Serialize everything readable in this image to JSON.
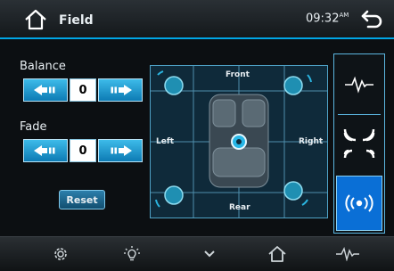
{
  "header": {
    "title": "Field",
    "time": "09:32",
    "time_suffix": "AM",
    "home_icon": "home-icon",
    "back_icon": "back-arrow-icon"
  },
  "balance": {
    "label": "Balance",
    "value": "0",
    "left_icon": "arrow-left-icon",
    "right_icon": "arrow-right-icon"
  },
  "fade": {
    "label": "Fade",
    "value": "0",
    "left_icon": "arrow-left-icon",
    "right_icon": "arrow-right-icon"
  },
  "reset_label": "Reset",
  "sound_field": {
    "front_label": "Front",
    "rear_label": "Rear",
    "left_label": "Left",
    "right_label": "Right"
  },
  "sidebar": {
    "items": [
      {
        "icon": "waveform-icon",
        "active": false
      },
      {
        "icon": "sound-waves-icon",
        "active": false
      },
      {
        "icon": "surround-icon",
        "active": true
      }
    ]
  },
  "bottom_nav": {
    "items": [
      {
        "icon": "gear-icon"
      },
      {
        "icon": "brightness-icon"
      },
      {
        "icon": "chevron-down-icon"
      },
      {
        "icon": "home-icon"
      },
      {
        "icon": "waveform-icon"
      }
    ]
  },
  "colors": {
    "accent": "#00a6e6",
    "button_blue": "#1a90cc",
    "sidebar_active": "#0a6fd6"
  }
}
